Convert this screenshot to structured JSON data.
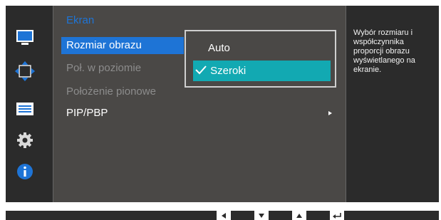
{
  "menu": {
    "title": "Ekran",
    "items": [
      {
        "label": "Rozmiar obrazu",
        "state": "selected"
      },
      {
        "label": "Poł. w poziomie",
        "state": "disabled"
      },
      {
        "label": "Położenie pionowe",
        "state": "disabled"
      },
      {
        "label": "PIP/PBP",
        "state": "enabled",
        "has_submenu": true
      }
    ]
  },
  "submenu": {
    "options": [
      {
        "label": "Auto",
        "checked": false
      },
      {
        "label": "Szeroki",
        "checked": true
      }
    ]
  },
  "info": {
    "text": "Wybór rozmiaru i współczynnika proporcji obrazu wyświetlanego na ekranie."
  },
  "side_icons": [
    "monitor-icon",
    "position-arrows-icon",
    "settings-list-icon",
    "gear-icon",
    "info-icon"
  ],
  "nav_keys": [
    "left-arrow-key",
    "down-arrow-key",
    "up-arrow-key",
    "enter-key"
  ],
  "colors": {
    "accent_blue": "#1e74d6",
    "highlight_teal": "#12a9b2",
    "panel": "#4a4846",
    "dark": "#2b2b2b"
  }
}
